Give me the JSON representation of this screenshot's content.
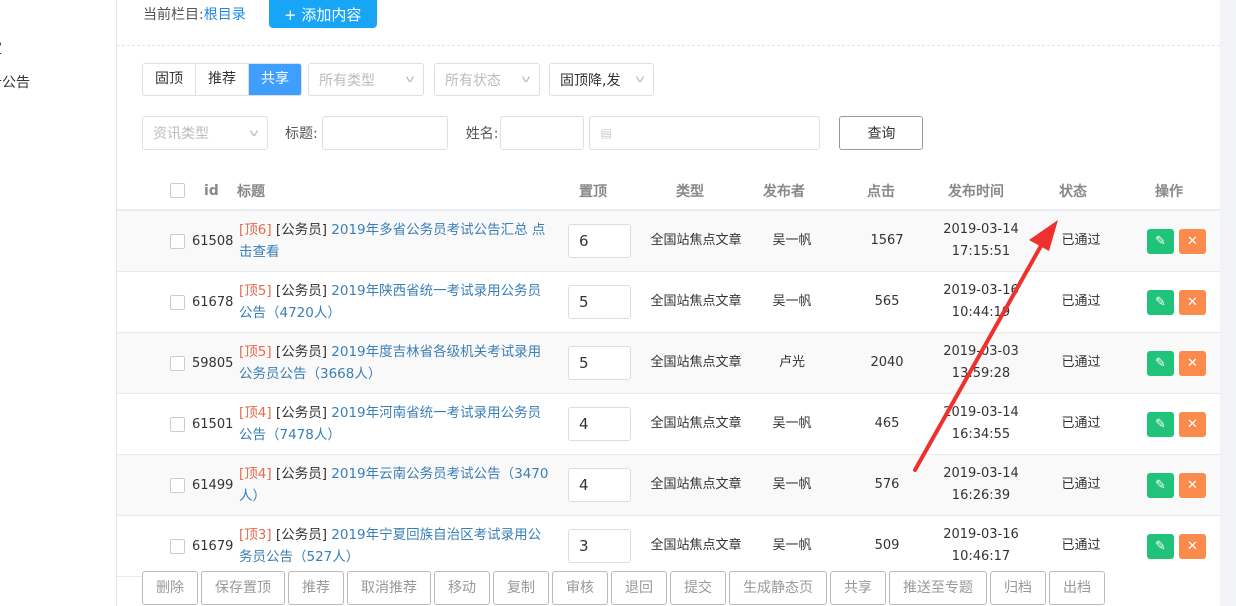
{
  "sidebar": {
    "items": [
      "定",
      "告公告"
    ]
  },
  "header": {
    "current_label": "当前栏目:",
    "current_value": "根目录",
    "add_button": "+ 添加内容"
  },
  "filters": {
    "toggles": [
      "固顶",
      "推荐",
      "共享"
    ],
    "active_toggle": "共享",
    "type_select": "所有类型",
    "status_select": "所有状态",
    "sort_select": "固顶降,发",
    "info_type_select": "资讯类型",
    "title_label": "标题:",
    "name_label": "姓名:",
    "query_button": "查询"
  },
  "table": {
    "headers": {
      "id": "id",
      "title": "标题",
      "top": "置顶",
      "type": "类型",
      "publisher": "发布者",
      "clicks": "点击",
      "time": "发布时间",
      "status": "状态",
      "ops": "操作"
    },
    "rows": [
      {
        "id": "61508",
        "tag": "[顶6]",
        "cat": "[公务员]",
        "title": "2019年多省公务员考试公告汇总 点击查看",
        "top": "6",
        "type": "全国站焦点文章",
        "publisher": "吴一帆",
        "clicks": "1567",
        "time": "2019-03-14 17:15:51",
        "status": "已通过"
      },
      {
        "id": "61678",
        "tag": "[顶5]",
        "cat": "[公务员]",
        "title": "2019年陕西省统一考试录用公务员公告（4720人）",
        "top": "5",
        "type": "全国站焦点文章",
        "publisher": "吴一帆",
        "clicks": "565",
        "time": "2019-03-16 10:44:19",
        "status": "已通过"
      },
      {
        "id": "59805",
        "tag": "[顶5]",
        "cat": "[公务员]",
        "title": "2019年度吉林省各级机关考试录用公务员公告（3668人）",
        "top": "5",
        "type": "全国站焦点文章",
        "publisher": "卢光",
        "clicks": "2040",
        "time": "2019-03-03 13:59:28",
        "status": "已通过"
      },
      {
        "id": "61501",
        "tag": "[顶4]",
        "cat": "[公务员]",
        "title": "2019年河南省统一考试录用公务员公告（7478人）",
        "top": "4",
        "type": "全国站焦点文章",
        "publisher": "吴一帆",
        "clicks": "465",
        "time": "2019-03-14 16:34:55",
        "status": "已通过"
      },
      {
        "id": "61499",
        "tag": "[顶4]",
        "cat": "[公务员]",
        "title": "2019年云南公务员考试公告（3470人）",
        "top": "4",
        "type": "全国站焦点文章",
        "publisher": "吴一帆",
        "clicks": "576",
        "time": "2019-03-14 16:26:39",
        "status": "已通过"
      },
      {
        "id": "61679",
        "tag": "[顶3]",
        "cat": "[公务员]",
        "title": "2019年宁夏回族自治区考试录用公务员公告（527人）",
        "top": "3",
        "type": "全国站焦点文章",
        "publisher": "吴一帆",
        "clicks": "509",
        "time": "2019-03-16 10:46:17",
        "status": "已通过"
      }
    ]
  },
  "actions": [
    "删除",
    "保存置顶",
    "推荐",
    "取消推荐",
    "移动",
    "复制",
    "审核",
    "退回",
    "提交",
    "生成静态页",
    "共享",
    "推送至专题",
    "归档",
    "出档"
  ],
  "colors": {
    "primary": "#19a5f5",
    "edit": "#21c27a",
    "delete": "#fb8a4d",
    "annotation": "#f0302e"
  }
}
